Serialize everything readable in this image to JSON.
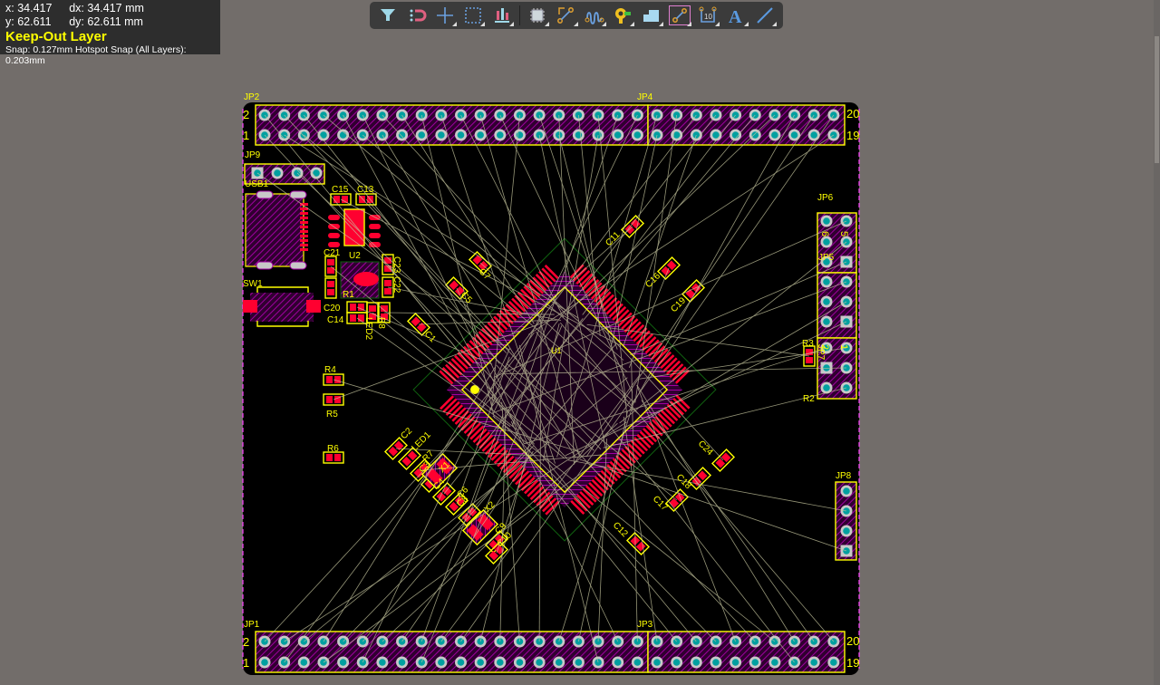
{
  "status": {
    "x_label": "x:",
    "x": "34.417",
    "dx": "dx: 34.417 mm",
    "y_label": "y:",
    "y": "62.611",
    "dy": "dy: 62.611 mm",
    "layer": "Keep-Out Layer",
    "snap": "Snap: 0.127mm Hotspot Snap (All Layers): 0.203mm"
  },
  "toolbar": [
    {
      "name": "filter-icon"
    },
    {
      "name": "interactive-routing-magnet-icon"
    },
    {
      "name": "crosshair-icon"
    },
    {
      "name": "select-area-icon"
    },
    {
      "name": "align-icon"
    },
    {
      "name": "component-icon"
    },
    {
      "name": "route-icon"
    },
    {
      "name": "tune-length-icon"
    },
    {
      "name": "via-icon"
    },
    {
      "name": "polygon-icon"
    },
    {
      "name": "place-track-icon",
      "selected": true
    },
    {
      "name": "dimension-icon",
      "text": "10"
    },
    {
      "name": "text-icon",
      "text": "A"
    },
    {
      "name": "line-icon"
    }
  ],
  "colors": {
    "board": "#000000",
    "silk": "#ffff00",
    "pad": "#ff0030",
    "mask": "#a000a0",
    "thru": "#00a0a0",
    "ratsnest": "#c8c8a0",
    "keepout": "#ff40ff"
  },
  "headers": {
    "JP2": "JP2",
    "JP4": "JP4",
    "JP1": "JP1",
    "JP3": "JP3",
    "top_left_2": "2",
    "top_left_1": "1",
    "top_right_20": "20",
    "top_right_19": "19",
    "bot_left_2": "2",
    "bot_left_1": "1",
    "bot_right_20": "20",
    "bot_right_19": "19"
  },
  "designators": [
    "JP9",
    "USB1",
    "C15",
    "C13",
    "U2",
    "C21",
    "C23",
    "C22",
    "R1",
    "SW1",
    "C20",
    "C14",
    "LED2",
    "R8",
    "C7",
    "C5",
    "C1",
    "U1",
    "C11",
    "C16",
    "C19",
    "JP6",
    "JP5",
    "JP7",
    "R3",
    "R2",
    "R4",
    "R5",
    "R6",
    "C2",
    "LED1",
    "R7",
    "C3",
    "X1",
    "C4",
    "C6",
    "C8",
    "X2",
    "C9",
    "C10",
    "C12",
    "C17",
    "C18",
    "C24",
    "JP8",
    "6",
    "5",
    "2",
    "1"
  ]
}
